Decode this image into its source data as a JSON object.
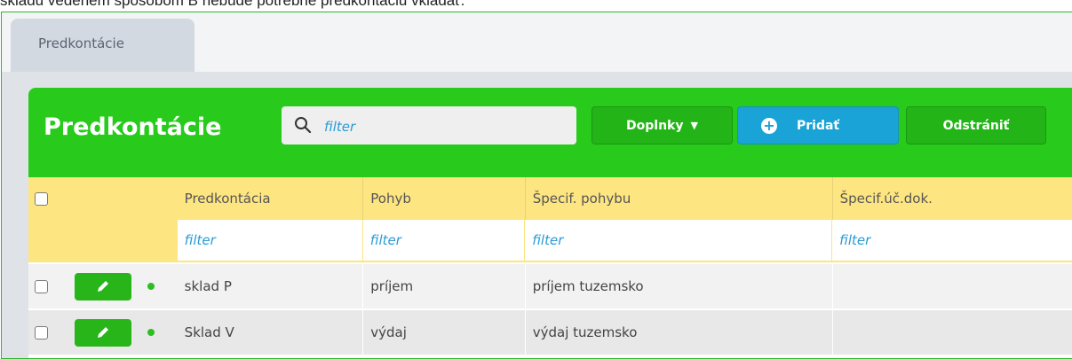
{
  "intro_text": "skladu vedeném spôsobom B nebude potrebné predkontáciu vkladať.",
  "tab": {
    "label": "Predkontácie"
  },
  "panel": {
    "title": "Predkontácie",
    "search_placeholder": "filter",
    "buttons": {
      "doplnky": "Doplnky",
      "pridat": "Pridať",
      "odstranit": "Odstrániť"
    }
  },
  "table": {
    "columns": [
      "Predkontácia",
      "Pohyb",
      "Špecif. pohybu",
      "Špecif.úč.dok."
    ],
    "filters": [
      "filter",
      "filter",
      "filter",
      "filter"
    ],
    "rows": [
      {
        "predkontacia": "sklad P",
        "pohyb": "príjem",
        "specif_pohybu": "príjem tuzemsko",
        "specif_uc_dok": "",
        "status": "active"
      },
      {
        "predkontacia": "Sklad V",
        "pohyb": "výdaj",
        "specif_pohybu": "výdaj tuzemsko",
        "specif_uc_dok": "",
        "status": "active"
      }
    ]
  },
  "colors": {
    "header_green": "#28cb1b",
    "table_header_yellow": "#fde581",
    "accent_blue": "#1aa3d6",
    "filter_text_blue": "#2a9bd6"
  },
  "icons": [
    "search-icon",
    "caret-down-icon",
    "plus-circle-icon",
    "pencil-icon",
    "status-dot-icon",
    "checkbox-icon"
  ]
}
